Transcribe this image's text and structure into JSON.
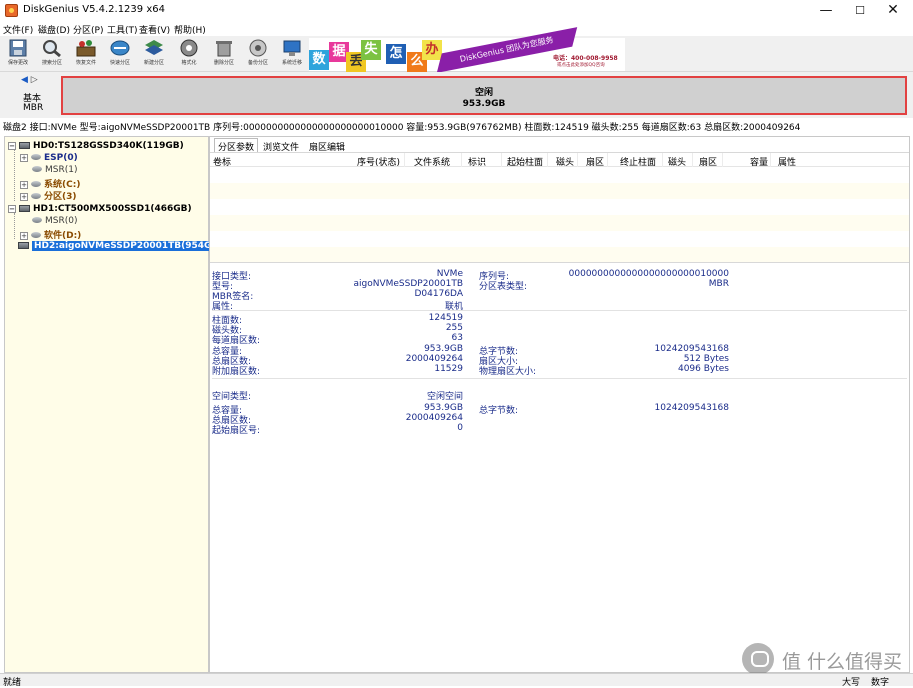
{
  "window": {
    "title": "DiskGenius V5.4.2.1239 x64",
    "minimize": "—",
    "maximize": "☐",
    "close": "✕"
  },
  "menu": [
    "文件(F)",
    "磁盘(D)",
    "分区(P)",
    "工具(T)",
    "查看(V)",
    "帮助(H)"
  ],
  "toolbar": [
    {
      "label": "保存更改",
      "icon": "save-icon"
    },
    {
      "label": "搜索分区",
      "icon": "search-partition-icon"
    },
    {
      "label": "恢复文件",
      "icon": "recover-files-icon"
    },
    {
      "label": "快速分区",
      "icon": "quick-partition-icon"
    },
    {
      "label": "新建分区",
      "icon": "new-partition-icon"
    },
    {
      "label": "格式化",
      "icon": "format-icon"
    },
    {
      "label": "删除分区",
      "icon": "delete-partition-icon"
    },
    {
      "label": "备份分区",
      "icon": "backup-partition-icon"
    },
    {
      "label": "系统迁移",
      "icon": "system-migration-icon"
    }
  ],
  "banner": {
    "chars": [
      "数",
      "据",
      "丢",
      "失",
      "怎",
      "么",
      "办"
    ],
    "slogan": "DiskGenius 团队为您服务",
    "phone": "电话：400-008-9958",
    "note": "或点击此处添加QQ咨询"
  },
  "disk_bar": {
    "type": "基本",
    "style": "MBR",
    "partition_label": "空闲",
    "partition_size": "953.9GB"
  },
  "info_strip": "磁盘2 接口:NVMe 型号:aigoNVMeSSDP20001TB 序列号:0000000000000000000000010000 容量:953.9GB(976762MB) 柱面数:124519 磁头数:255 每道扇区数:63 总扇区数:2000409264",
  "tree": [
    {
      "label": "HD0:TS128GSSD340K(119GB)",
      "kind": "disk"
    },
    {
      "label": "ESP(0)",
      "kind": "part-blue"
    },
    {
      "label": "MSR(1)",
      "kind": "part-gray"
    },
    {
      "label": "系统(C:)",
      "kind": "part-brown"
    },
    {
      "label": "分区(3)",
      "kind": "part-brown"
    },
    {
      "label": "HD1:CT500MX500SSD1(466GB)",
      "kind": "disk"
    },
    {
      "label": "MSR(0)",
      "kind": "part-gray"
    },
    {
      "label": "软件(D:)",
      "kind": "part-brown"
    },
    {
      "label": "HD2:aigoNVMeSSDP20001TB(954GB)",
      "kind": "disk-selected"
    }
  ],
  "tabs": [
    "分区参数",
    "浏览文件",
    "扇区编辑"
  ],
  "table_headers": [
    "卷标",
    "序号(状态)",
    "文件系统",
    "标识",
    "起始柱面",
    "磁头",
    "扇区",
    "终止柱面",
    "磁头",
    "扇区",
    "容量",
    "属性"
  ],
  "details": {
    "iface_label": "接口类型:",
    "iface_value": "NVMe",
    "sn_label": "序列号:",
    "sn_value": "0000000000000000000000010000",
    "model_label": "型号:",
    "model_value": "aigoNVMeSSDP20001TB",
    "pstyle_label": "分区表类型:",
    "pstyle_value": "MBR",
    "mbr_label": "MBR签名:",
    "mbr_value": "D04176DA",
    "attr_label": "属性:",
    "attr_value": "联机",
    "cyl_label": "柱面数:",
    "cyl_value": "124519",
    "heads_label": "磁头数:",
    "heads_value": "255",
    "spt_label": "每道扇区数:",
    "spt_value": "63",
    "cap_label": "总容量:",
    "cap_value": "953.9GB",
    "bytes_label": "总字节数:",
    "bytes_value": "1024209543168",
    "sectors_label": "总扇区数:",
    "sectors_value": "2000409264",
    "secsize_label": "扇区大小:",
    "secsize_value": "512 Bytes",
    "extra_label": "附加扇区数:",
    "extra_value": "11529",
    "phys_label": "物理扇区大小:",
    "phys_value": "4096 Bytes",
    "space_label": "空间类型:",
    "space_value": "空闲空间",
    "scap_label": "总容量:",
    "scap_value": "953.9GB",
    "sbytes_label": "总字节数:",
    "sbytes_value": "1024209543168",
    "ssectors_label": "总扇区数:",
    "ssectors_value": "2000409264",
    "start_label": "起始扇区号:",
    "start_value": "0"
  },
  "status": {
    "text": "就绪",
    "caps": "大写",
    "num": "数字"
  },
  "watermark": "值 什么值得买"
}
